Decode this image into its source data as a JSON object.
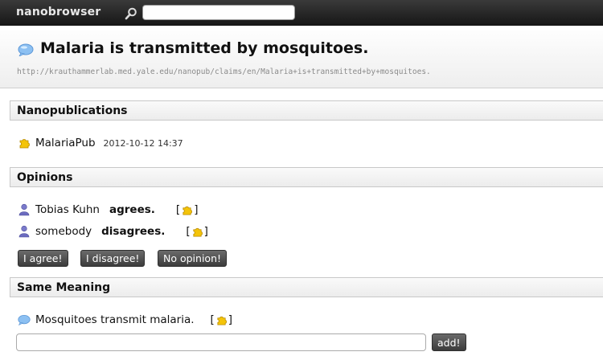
{
  "app": {
    "name": "nanobrowser"
  },
  "search": {
    "value": "",
    "placeholder": ""
  },
  "claim": {
    "title": "Malaria is transmitted by mosquitoes.",
    "url": "http://krauthammerlab.med.yale.edu/nanopub/claims/en/Malaria+is+transmitted+by+mosquitoes."
  },
  "sections": {
    "nanopublications": "Nanopublications",
    "opinions": "Opinions",
    "same_meaning": "Same Meaning"
  },
  "nanopublications": [
    {
      "name": "MalariaPub",
      "date": "2012-10-12 14:37"
    }
  ],
  "opinions": [
    {
      "person": "Tobias Kuhn",
      "stance": "agrees."
    },
    {
      "person": "somebody",
      "stance": "disagrees."
    }
  ],
  "brackets": {
    "open": "[",
    "close": "]"
  },
  "opinion_buttons": {
    "agree": "I agree!",
    "disagree": "I disagree!",
    "no_opinion": "No opinion!"
  },
  "same_meaning": [
    {
      "text": "Mosquitoes transmit malaria."
    }
  ],
  "add": {
    "value": "",
    "button": "add!"
  },
  "icons": {
    "search": "magnifier-icon",
    "claim": "speech-bubble-icon",
    "nanopub": "puzzle-piece-icon",
    "person": "person-icon"
  },
  "colors": {
    "topbar": "#1f1f1f",
    "bubble": "#7fb6ee",
    "puzzle": "#f2c200",
    "person": "#6f6fc0"
  }
}
